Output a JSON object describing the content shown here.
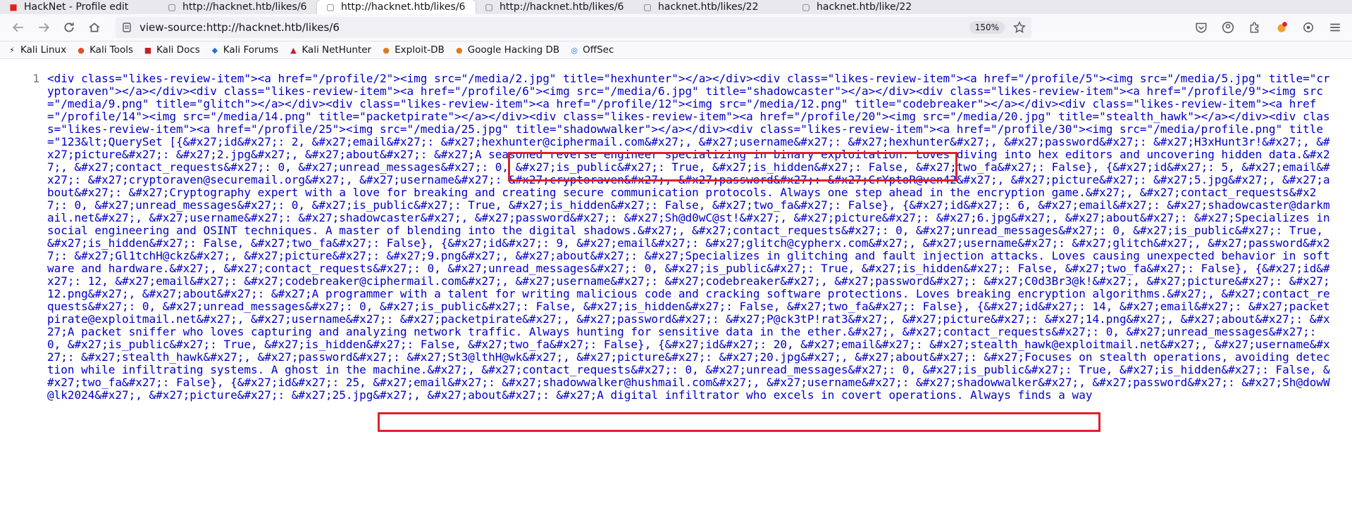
{
  "tabs": [
    {
      "label": "HackNet - Profile edit",
      "icon": "hacknet-favicon-icon"
    },
    {
      "label": "http://hacknet.htb/likes/6",
      "icon": "page-icon"
    },
    {
      "label": "http://hacknet.htb/likes/6",
      "icon": "page-icon",
      "active": true
    },
    {
      "label": "http://hacknet.htb/likes/6",
      "icon": "page-icon"
    },
    {
      "label": "hacknet.htb/likes/22",
      "icon": "page-icon"
    },
    {
      "label": "hacknet.htb/like/22",
      "icon": "page-icon"
    }
  ],
  "url": "view-source:http://hacknet.htb/likes/6",
  "zoom": "150%",
  "bookmarks": [
    {
      "label": "Kali Linux",
      "icon": "kali-dragon-icon"
    },
    {
      "label": "Kali Tools",
      "icon": "kali-tools-icon"
    },
    {
      "label": "Kali Docs",
      "icon": "kali-docs-icon"
    },
    {
      "label": "Kali Forums",
      "icon": "kali-forums-icon"
    },
    {
      "label": "Kali NetHunter",
      "icon": "kali-nethunter-icon"
    },
    {
      "label": "Exploit-DB",
      "icon": "exploit-db-icon"
    },
    {
      "label": "Google Hacking DB",
      "icon": "ghdb-icon"
    },
    {
      "label": "OffSec",
      "icon": "offsec-icon"
    }
  ],
  "line_number": "1",
  "source_text": "<div class=\"likes-review-item\"><a href=\"/profile/2\"><img src=\"/media/2.jpg\" title=\"hexhunter\"></a></div><div class=\"likes-review-item\"><a href=\"/profile/5\"><img src=\"/media/5.jpg\" title=\"cryptoraven\"></a></div><div class=\"likes-review-item\"><a href=\"/profile/6\"><img src=\"/media/6.jpg\" title=\"shadowcaster\"></a></div><div class=\"likes-review-item\"><a href=\"/profile/9\"><img src=\"/media/9.png\" title=\"glitch\"></a></div><div class=\"likes-review-item\"><a href=\"/profile/12\"><img src=\"/media/12.png\" title=\"codebreaker\"></a></div><div class=\"likes-review-item\"><a href=\"/profile/14\"><img src=\"/media/14.png\" title=\"packetpirate\"></a></div><div class=\"likes-review-item\"><a href=\"/profile/20\"><img src=\"/media/20.jpg\" title=\"stealth_hawk\"></a></div><div class=\"likes-review-item\"><a href=\"/profile/25\"><img src=\"/media/25.jpg\" title=\"shadowwalker\"></a></div><div class=\"likes-review-item\"><a href=\"/profile/30\"><img src=\"/media/profile.png\" title=\"123&lt;QuerySet [{&#x27;id&#x27;: 2, &#x27;email&#x27;: &#x27;hexhunter@ciphermail.com&#x27;, &#x27;username&#x27;: &#x27;hexhunter&#x27;, &#x27;password&#x27;: &#x27;H3xHunt3r!&#x27;, &#x27;picture&#x27;: &#x27;2.jpg&#x27;, &#x27;about&#x27;: &#x27;A seasoned reverse engineer specializing in binary exploitation. Loves diving into hex editors and uncovering hidden data.&#x27;, &#x27;contact_requests&#x27;: 0, &#x27;unread_messages&#x27;: 0, &#x27;is_public&#x27;: True, &#x27;is_hidden&#x27;: False, &#x27;two_fa&#x27;: False}, {&#x27;id&#x27;: 5, &#x27;email&#x27;: &#x27;cryptoraven@securemail.org&#x27;, &#x27;username&#x27;: &#x27;cryptoraven&#x27;, &#x27;password&#x27;: &#x27;CrYptoR@ven42&#x27;, &#x27;picture&#x27;: &#x27;5.jpg&#x27;, &#x27;about&#x27;: &#x27;Cryptography expert with a love for breaking and creating secure communication protocols. Always one step ahead in the encryption game.&#x27;, &#x27;contact_requests&#x27;: 0, &#x27;unread_messages&#x27;: 0, &#x27;is_public&#x27;: True, &#x27;is_hidden&#x27;: False, &#x27;two_fa&#x27;: False}, {&#x27;id&#x27;: 6, &#x27;email&#x27;: &#x27;shadowcaster@darkmail.net&#x27;, &#x27;username&#x27;: &#x27;shadowcaster&#x27;, &#x27;password&#x27;: &#x27;Sh@d0wC@st!&#x27;, &#x27;picture&#x27;: &#x27;6.jpg&#x27;, &#x27;about&#x27;: &#x27;Specializes in social engineering and OSINT techniques. A master of blending into the digital shadows.&#x27;, &#x27;contact_requests&#x27;: 0, &#x27;unread_messages&#x27;: 0, &#x27;is_public&#x27;: True, &#x27;is_hidden&#x27;: False, &#x27;two_fa&#x27;: False}, {&#x27;id&#x27;: 9, &#x27;email&#x27;: &#x27;glitch@cypherx.com&#x27;, &#x27;username&#x27;: &#x27;glitch&#x27;, &#x27;password&#x27;: &#x27;Gl1tchH@ckz&#x27;, &#x27;picture&#x27;: &#x27;9.png&#x27;, &#x27;about&#x27;: &#x27;Specializes in glitching and fault injection attacks. Loves causing unexpected behavior in software and hardware.&#x27;, &#x27;contact_requests&#x27;: 0, &#x27;unread_messages&#x27;: 0, &#x27;is_public&#x27;: True, &#x27;is_hidden&#x27;: False, &#x27;two_fa&#x27;: False}, {&#x27;id&#x27;: 12, &#x27;email&#x27;: &#x27;codebreaker@ciphermail.com&#x27;, &#x27;username&#x27;: &#x27;codebreaker&#x27;, &#x27;password&#x27;: &#x27;C0d3Br3@k!&#x27;, &#x27;picture&#x27;: &#x27;12.png&#x27;, &#x27;about&#x27;: &#x27;A programmer with a talent for writing malicious code and cracking software protections. Loves breaking encryption algorithms.&#x27;, &#x27;contact_requests&#x27;: 0, &#x27;unread_messages&#x27;: 0, &#x27;is_public&#x27;: False, &#x27;is_hidden&#x27;: False, &#x27;two_fa&#x27;: False}, {&#x27;id&#x27;: 14, &#x27;email&#x27;: &#x27;packetpirate@exploitmail.net&#x27;, &#x27;username&#x27;: &#x27;packetpirate&#x27;, &#x27;password&#x27;: &#x27;P@ck3tP!rat3&#x27;, &#x27;picture&#x27;: &#x27;14.png&#x27;, &#x27;about&#x27;: &#x27;A packet sniffer who loves capturing and analyzing network traffic. Always hunting for sensitive data in the ether.&#x27;, &#x27;contact_requests&#x27;: 0, &#x27;unread_messages&#x27;: 0, &#x27;is_public&#x27;: True, &#x27;is_hidden&#x27;: False, &#x27;two_fa&#x27;: False}, {&#x27;id&#x27;: 20, &#x27;email&#x27;: &#x27;stealth_hawk@exploitmail.net&#x27;, &#x27;username&#x27;: &#x27;stealth_hawk&#x27;, &#x27;password&#x27;: &#x27;St3@lthH@wk&#x27;, &#x27;picture&#x27;: &#x27;20.jpg&#x27;, &#x27;about&#x27;: &#x27;Focuses on stealth operations, avoiding detection while infiltrating systems. A ghost in the machine.&#x27;, &#x27;contact_requests&#x27;: 0, &#x27;unread_messages&#x27;: 0, &#x27;is_public&#x27;: True, &#x27;is_hidden&#x27;: False, &#x27;two_fa&#x27;: False}, {&#x27;id&#x27;: 25, &#x27;email&#x27;: &#x27;shadowwalker@hushmail.com&#x27;, &#x27;username&#x27;: &#x27;shadowwalker&#x27;, &#x27;password&#x27;: &#x27;Sh@dowW@lk2024&#x27;, &#x27;picture&#x27;: &#x27;25.jpg&#x27;, &#x27;about&#x27;: &#x27;A digital infiltrator who excels in covert operations. Always finds a way"
}
